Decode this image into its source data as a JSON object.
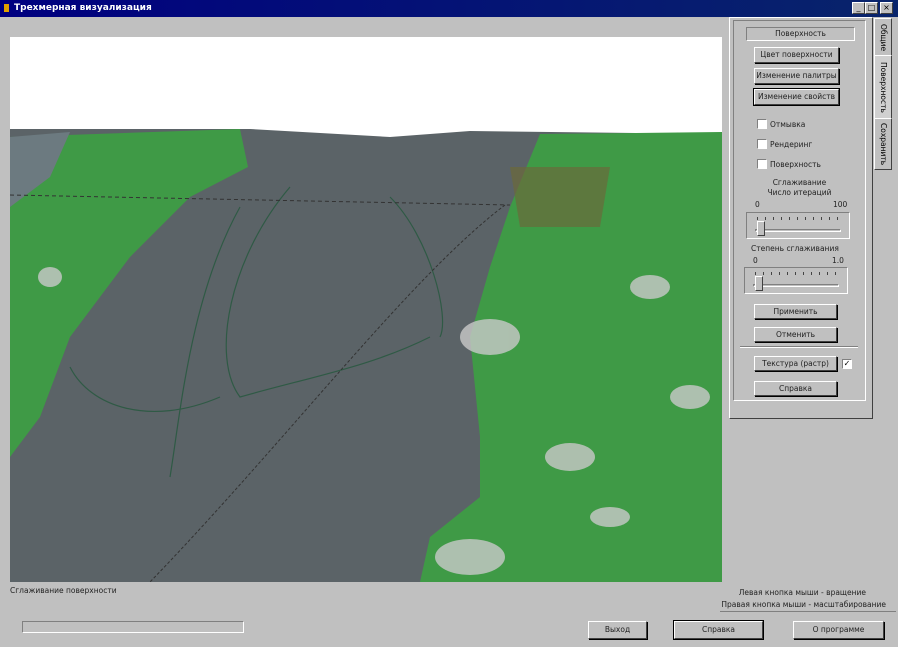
{
  "window": {
    "title": "Трехмерная визуализация",
    "controls": {
      "minimize": "_",
      "maximize": "□",
      "close": "×"
    }
  },
  "tabs": [
    {
      "label": "Общие",
      "active": false
    },
    {
      "label": "Поверхность",
      "active": true
    },
    {
      "label": "Сохранить",
      "active": false
    }
  ],
  "panel": {
    "header": "Поверхность",
    "buttons": {
      "surface_color": "Цвет поверхности",
      "palette": "Изменение палитры",
      "properties": "Изменение свойств",
      "apply": "Применить",
      "cancel": "Отменить",
      "texture": "Текстура (растр)",
      "help": "Справка"
    },
    "checkboxes": [
      {
        "label": "Отмывка",
        "checked": false
      },
      {
        "label": "Рендеринг",
        "checked": false
      },
      {
        "label": "Поверхность",
        "checked": false
      }
    ],
    "smoothing_title": "Сглаживание",
    "iterations": {
      "label": "Число итераций",
      "min": "0",
      "max": "100",
      "value_fraction": 0.05
    },
    "degree": {
      "label": "Степень сглаживания",
      "min": "0",
      "max": "1.0",
      "value_fraction": 0.05
    },
    "texture_checked": true
  },
  "status": {
    "left": "Сглаживание поверхности",
    "hint1": "Левая кнопка мыши - вращение",
    "hint2": "Правая кнопка мыши - масштабирование",
    "progress": 0
  },
  "footer": {
    "exit": "Выход",
    "help": "Справка",
    "about": "О программе"
  },
  "colors": {
    "titlebar": "#000080",
    "sky": "#ffffff",
    "water": "#5b6367",
    "land": "#3f9a46",
    "bg": "#c0c0c0"
  }
}
